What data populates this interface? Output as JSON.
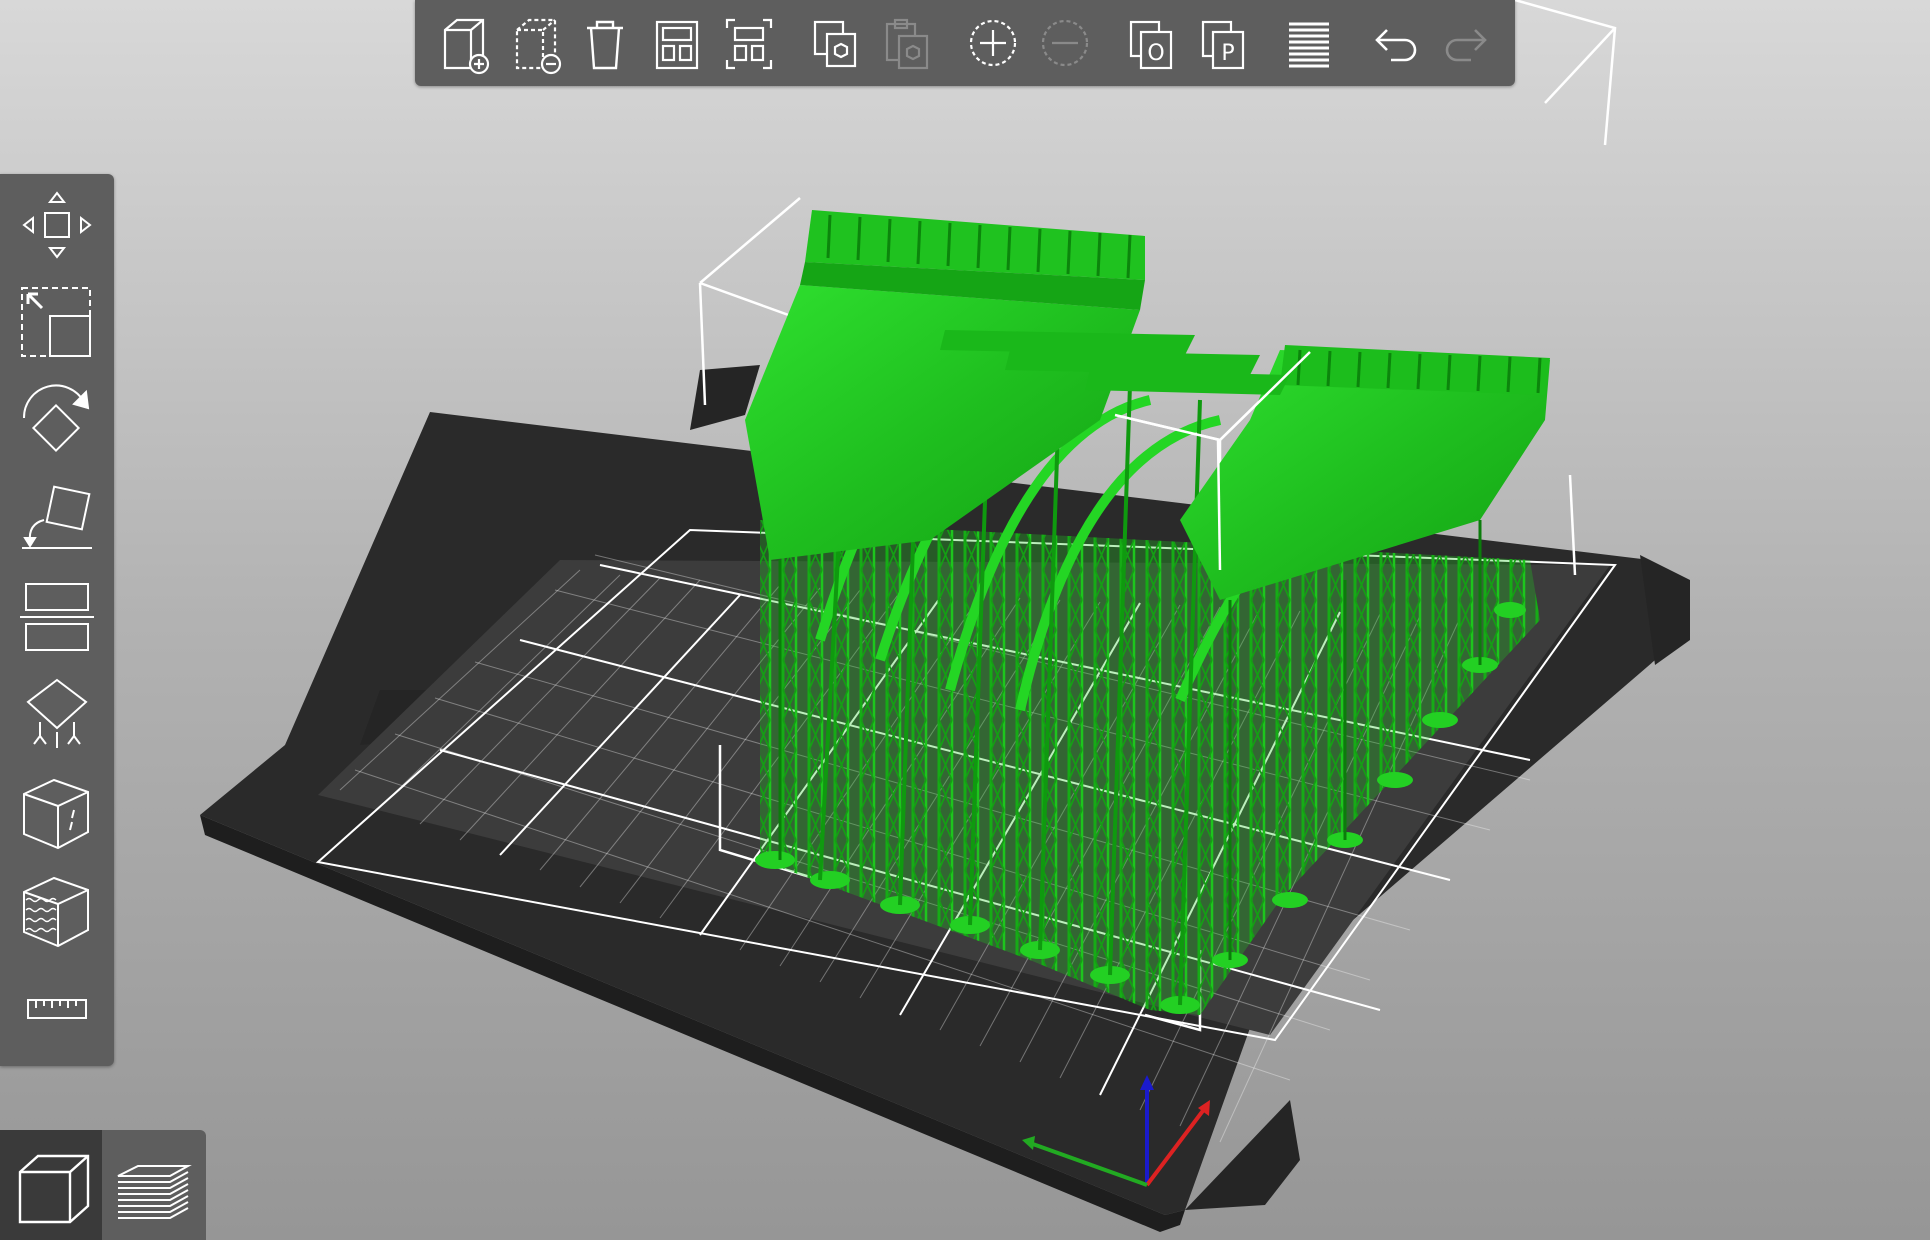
{
  "app": {
    "top_toolbar": [
      {
        "id": "add",
        "icon": "add-object-icon",
        "enabled": true
      },
      {
        "id": "delete",
        "icon": "delete-object-icon",
        "enabled": true
      },
      {
        "id": "delete_all",
        "icon": "trash-icon",
        "enabled": true
      },
      {
        "id": "arrange",
        "icon": "arrange-icon",
        "enabled": true
      },
      {
        "id": "arrange_selection",
        "icon": "arrange-selection-icon",
        "enabled": true
      },
      {
        "id": "copy",
        "icon": "copy-icon",
        "enabled": true
      },
      {
        "id": "paste",
        "icon": "paste-icon",
        "enabled": false
      },
      {
        "id": "add_instance",
        "icon": "add-instance-icon",
        "enabled": true
      },
      {
        "id": "remove_instance",
        "icon": "remove-instance-icon",
        "enabled": false
      },
      {
        "id": "split_objects",
        "icon": "split-objects-icon",
        "label": "O",
        "enabled": true
      },
      {
        "id": "split_parts",
        "icon": "split-parts-icon",
        "label": "P",
        "enabled": true
      },
      {
        "id": "variable_layer_height",
        "icon": "layers-icon",
        "enabled": true
      },
      {
        "id": "undo",
        "icon": "undo-icon",
        "enabled": true
      },
      {
        "id": "redo",
        "icon": "redo-icon",
        "enabled": false
      }
    ],
    "left_toolbar": [
      {
        "id": "move",
        "icon": "move-icon"
      },
      {
        "id": "scale",
        "icon": "scale-icon"
      },
      {
        "id": "rotate",
        "icon": "rotate-icon"
      },
      {
        "id": "place_on_face",
        "icon": "place-on-face-icon"
      },
      {
        "id": "cut",
        "icon": "cut-icon"
      },
      {
        "id": "support_painting",
        "icon": "support-painting-icon"
      },
      {
        "id": "seam_painting",
        "icon": "seam-painting-icon"
      },
      {
        "id": "fuzzy_skin",
        "icon": "fuzzy-skin-icon"
      },
      {
        "id": "measure",
        "icon": "measure-icon"
      }
    ],
    "view_toggle": [
      {
        "id": "3d_view",
        "icon": "3d-view-icon",
        "active": true
      },
      {
        "id": "preview",
        "icon": "preview-layers-icon",
        "active": false
      }
    ],
    "colors": {
      "background_top": "#d6d6d6",
      "background_bottom": "#9a9a9a",
      "toolbar": "#5e5e5e",
      "bed": "#2c2c2c",
      "bed_grid": "#ffffff",
      "model": "#22c922",
      "axis_x": "#dd2222",
      "axis_y": "#22aa22",
      "axis_z": "#1a1acc"
    }
  }
}
